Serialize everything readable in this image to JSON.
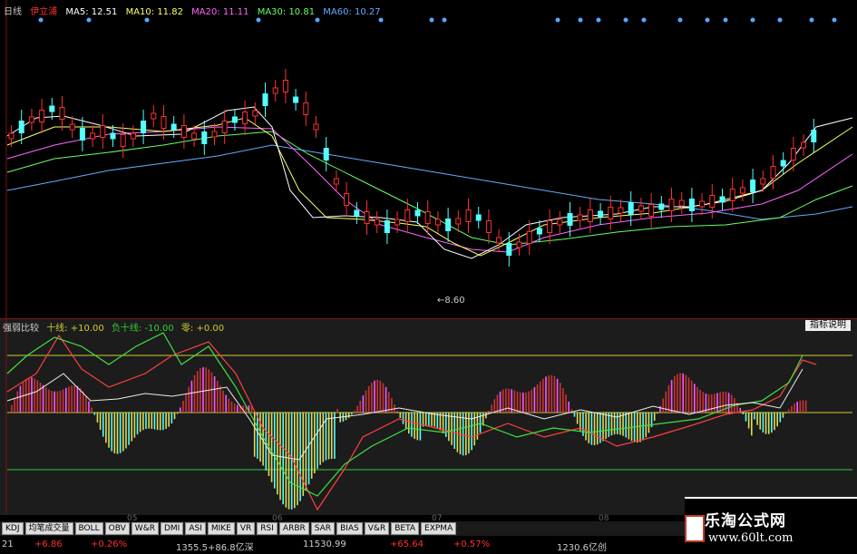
{
  "main_chart": {
    "period_label": "日线",
    "stock_name": "伊立浦",
    "ma": [
      {
        "label": "MA5: 12.51",
        "color": "#ffffff"
      },
      {
        "label": "MA10: 11.82",
        "color": "#ffff66"
      },
      {
        "label": "MA20: 11.11",
        "color": "#ff66ff"
      },
      {
        "label": "MA30: 10.81",
        "color": "#66ff66"
      },
      {
        "label": "MA60: 10.27",
        "color": "#66aaff"
      }
    ],
    "low_price_label": "8.60"
  },
  "indicator": {
    "name": "强弱比较",
    "plus_line": "十线: +10.00",
    "minus_line": "负十线: -10.00",
    "zero_line": "零: +0.00",
    "help_button": "指标说明"
  },
  "dates": [
    "05",
    "06",
    "07",
    "08"
  ],
  "tabs": [
    "KDJ",
    "均笔成交量",
    "BOLL",
    "OBV",
    "W&R",
    "DMI",
    "ASI",
    "MIKE",
    "VR",
    "RSI",
    "ARBR",
    "SAR",
    "BIAS",
    "V&R",
    "BETA",
    "EXPMA"
  ],
  "status_bar": {
    "left_index": "21",
    "change1": "+6.86",
    "pct1": "+0.26%",
    "volume1": "1355.5+86.8亿深",
    "index2": "11530.99",
    "change2": "+65.64",
    "pct2": "+0.57%",
    "volume2": "1230.6亿创"
  },
  "watermark": {
    "title": "乐淘公式网",
    "url": "www.60lt.com"
  },
  "colors": {
    "up": "#ff3030",
    "down": "#55ffff",
    "background": "#000000",
    "tab_bg": "#dddddd"
  }
}
